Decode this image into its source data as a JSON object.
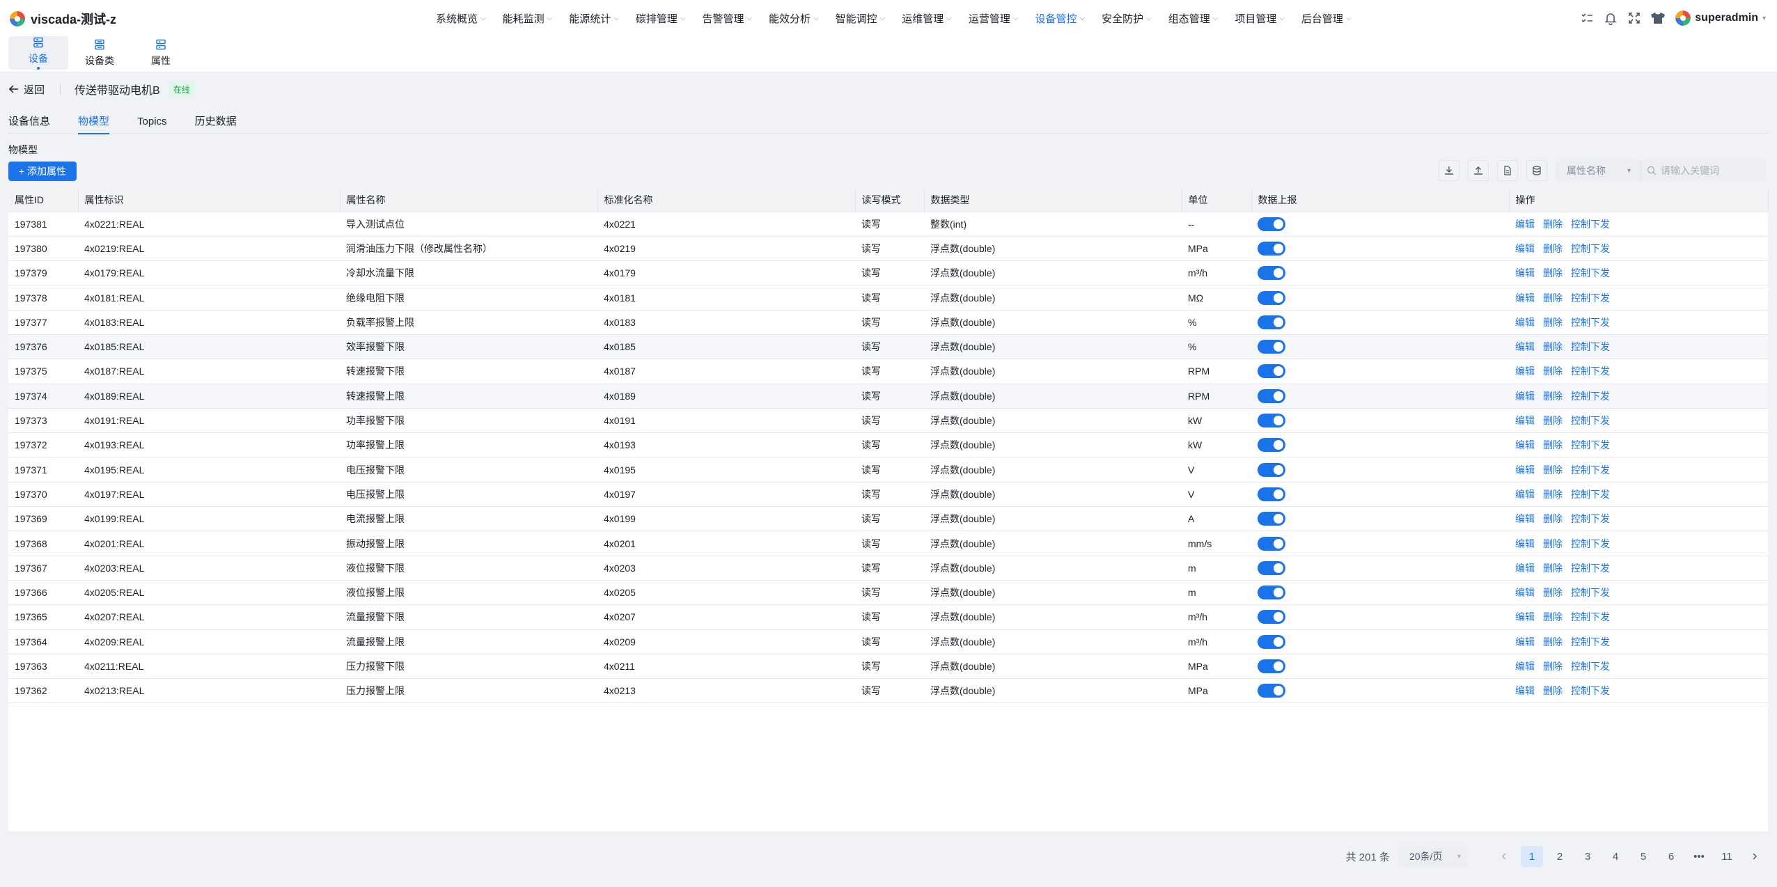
{
  "brand": {
    "title": "viscada-测试-z"
  },
  "menu": [
    {
      "label": "系统概览",
      "active": false
    },
    {
      "label": "能耗监测",
      "active": false
    },
    {
      "label": "能源统计",
      "active": false
    },
    {
      "label": "碳排管理",
      "active": false
    },
    {
      "label": "告警管理",
      "active": false
    },
    {
      "label": "能效分析",
      "active": false
    },
    {
      "label": "智能调控",
      "active": false
    },
    {
      "label": "运维管理",
      "active": false
    },
    {
      "label": "运营管理",
      "active": false
    },
    {
      "label": "设备管控",
      "active": true
    },
    {
      "label": "安全防护",
      "active": false
    },
    {
      "label": "组态管理",
      "active": false
    },
    {
      "label": "项目管理",
      "active": false
    },
    {
      "label": "后台管理",
      "active": false
    }
  ],
  "user": {
    "name": "superadmin"
  },
  "subnav": [
    {
      "label": "设备",
      "active": true
    },
    {
      "label": "设备类",
      "active": false
    },
    {
      "label": "属性",
      "active": false
    }
  ],
  "header": {
    "back_label": "返回",
    "device_name": "传送带驱动电机B",
    "status": "在线"
  },
  "tabs": [
    {
      "label": "设备信息",
      "active": false
    },
    {
      "label": "物模型",
      "active": true
    },
    {
      "label": "Topics",
      "active": false
    },
    {
      "label": "历史数据",
      "active": false
    }
  ],
  "section_label": "物模型",
  "add_button": "+ 添加属性",
  "filter": {
    "select_label": "属性名称",
    "search_placeholder": "请输入关键词"
  },
  "table": {
    "columns": [
      "属性ID",
      "属性标识",
      "属性名称",
      "标准化名称",
      "读写模式",
      "数据类型",
      "单位",
      "数据上报",
      "操作"
    ],
    "actions": [
      "编辑",
      "删除",
      "控制下发"
    ],
    "rows": [
      {
        "id": "197381",
        "key": "4x0221:REAL",
        "name": "导入测试点位",
        "std": "4x0221",
        "rw": "读写",
        "type": "整数(int)",
        "unit": "--",
        "report": true
      },
      {
        "id": "197380",
        "key": "4x0219:REAL",
        "name": "润滑油压力下限（修改属性名称）",
        "std": "4x0219",
        "rw": "读写",
        "type": "浮点数(double)",
        "unit": "MPa",
        "report": true
      },
      {
        "id": "197379",
        "key": "4x0179:REAL",
        "name": "冷却水流量下限",
        "std": "4x0179",
        "rw": "读写",
        "type": "浮点数(double)",
        "unit": "m³/h",
        "report": true
      },
      {
        "id": "197378",
        "key": "4x0181:REAL",
        "name": "绝缘电阻下限",
        "std": "4x0181",
        "rw": "读写",
        "type": "浮点数(double)",
        "unit": "MΩ",
        "report": true
      },
      {
        "id": "197377",
        "key": "4x0183:REAL",
        "name": "负载率报警上限",
        "std": "4x0183",
        "rw": "读写",
        "type": "浮点数(double)",
        "unit": "%",
        "report": true
      },
      {
        "id": "197376",
        "key": "4x0185:REAL",
        "name": "效率报警下限",
        "std": "4x0185",
        "rw": "读写",
        "type": "浮点数(double)",
        "unit": "%",
        "report": true
      },
      {
        "id": "197375",
        "key": "4x0187:REAL",
        "name": "转速报警下限",
        "std": "4x0187",
        "rw": "读写",
        "type": "浮点数(double)",
        "unit": "RPM",
        "report": true
      },
      {
        "id": "197374",
        "key": "4x0189:REAL",
        "name": "转速报警上限",
        "std": "4x0189",
        "rw": "读写",
        "type": "浮点数(double)",
        "unit": "RPM",
        "report": true
      },
      {
        "id": "197373",
        "key": "4x0191:REAL",
        "name": "功率报警下限",
        "std": "4x0191",
        "rw": "读写",
        "type": "浮点数(double)",
        "unit": "kW",
        "report": true
      },
      {
        "id": "197372",
        "key": "4x0193:REAL",
        "name": "功率报警上限",
        "std": "4x0193",
        "rw": "读写",
        "type": "浮点数(double)",
        "unit": "kW",
        "report": true
      },
      {
        "id": "197371",
        "key": "4x0195:REAL",
        "name": "电压报警下限",
        "std": "4x0195",
        "rw": "读写",
        "type": "浮点数(double)",
        "unit": "V",
        "report": true
      },
      {
        "id": "197370",
        "key": "4x0197:REAL",
        "name": "电压报警上限",
        "std": "4x0197",
        "rw": "读写",
        "type": "浮点数(double)",
        "unit": "V",
        "report": true
      },
      {
        "id": "197369",
        "key": "4x0199:REAL",
        "name": "电流报警上限",
        "std": "4x0199",
        "rw": "读写",
        "type": "浮点数(double)",
        "unit": "A",
        "report": true
      },
      {
        "id": "197368",
        "key": "4x0201:REAL",
        "name": "振动报警上限",
        "std": "4x0201",
        "rw": "读写",
        "type": "浮点数(double)",
        "unit": "mm/s",
        "report": true
      },
      {
        "id": "197367",
        "key": "4x0203:REAL",
        "name": "液位报警下限",
        "std": "4x0203",
        "rw": "读写",
        "type": "浮点数(double)",
        "unit": "m",
        "report": true
      },
      {
        "id": "197366",
        "key": "4x0205:REAL",
        "name": "液位报警上限",
        "std": "4x0205",
        "rw": "读写",
        "type": "浮点数(double)",
        "unit": "m",
        "report": true
      },
      {
        "id": "197365",
        "key": "4x0207:REAL",
        "name": "流量报警下限",
        "std": "4x0207",
        "rw": "读写",
        "type": "浮点数(double)",
        "unit": "m³/h",
        "report": true
      },
      {
        "id": "197364",
        "key": "4x0209:REAL",
        "name": "流量报警上限",
        "std": "4x0209",
        "rw": "读写",
        "type": "浮点数(double)",
        "unit": "m³/h",
        "report": true
      },
      {
        "id": "197363",
        "key": "4x0211:REAL",
        "name": "压力报警下限",
        "std": "4x0211",
        "rw": "读写",
        "type": "浮点数(double)",
        "unit": "MPa",
        "report": true
      },
      {
        "id": "197362",
        "key": "4x0213:REAL",
        "name": "压力报警上限",
        "std": "4x0213",
        "rw": "读写",
        "type": "浮点数(double)",
        "unit": "MPa",
        "report": true
      }
    ]
  },
  "pagination": {
    "total": "共 201 条",
    "page_size": "20条/页",
    "pages": [
      "1",
      "2",
      "3",
      "4",
      "5",
      "6",
      "•••",
      "11"
    ],
    "current": "1"
  },
  "colors": {
    "accent": "#1a73e8",
    "status_online": "#16a34a",
    "status_online_bg": "#e3f6ec"
  }
}
